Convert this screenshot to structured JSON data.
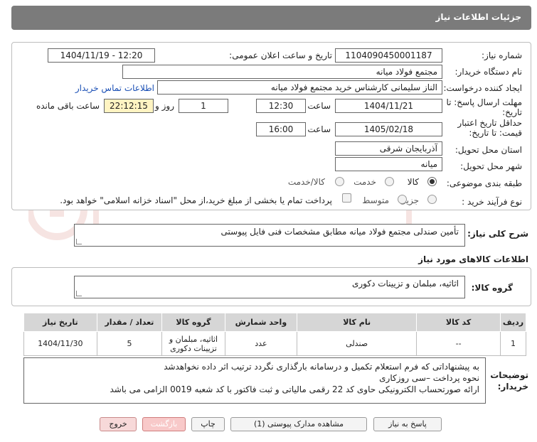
{
  "header": {
    "title": "جزئیات اطلاعات نیاز"
  },
  "form": {
    "need_number_label": "شماره نیاز:",
    "need_number": "1104090450001187",
    "announce_label": "تاریخ و ساعت اعلان عمومی:",
    "announce_value": "1404/11/19 - 12:20",
    "buyer_label": "نام دستگاه خریدار:",
    "buyer_value": "مجتمع فولاد میانه",
    "creator_label": "ایجاد کننده درخواست:",
    "creator_value": "الناز سلیمانی کارشناس خرید مجتمع فولاد میانه",
    "contact_link": "اطلاعات تماس خریدار",
    "deadline_label": "مهلت ارسال پاسخ: تا تاریخ:",
    "deadline_date": "1404/11/21",
    "time_label": "ساعت",
    "deadline_time": "12:30",
    "days_value": "1",
    "days_and_label": "روز و",
    "remaining_time": "22:12:15",
    "remaining_label": "ساعت باقی مانده",
    "validity_label": "حداقل تاریخ اعتبار قیمت: تا تاریخ:",
    "validity_date": "1405/02/18",
    "validity_time": "16:00",
    "province_label": "استان محل تحویل:",
    "province_value": "آذربایجان شرقی",
    "city_label": "شهر محل تحویل:",
    "city_value": "میانه",
    "category_label": "طبقه بندی موضوعی:",
    "category_options": [
      "کالا",
      "خدمت",
      "کالا/خدمت"
    ],
    "process_label": "نوع فرآیند خرید :",
    "process_options": [
      "جزیی",
      "متوسط"
    ],
    "payment_note": "پرداخت تمام یا بخشی از مبلغ خرید،از محل \"اسناد خزانه اسلامی\" خواهد بود."
  },
  "general": {
    "desc_label": "شرح کلی نیاز:",
    "desc_value": "تأمین صندلی مجتمع فولاد میانه مطابق مشخصات فنی فایل پیوستی",
    "goods_info_title": "اطلاعات کالاهای مورد نیاز",
    "goods_group_label": "گروه کالا:",
    "goods_group_value": "اثاثیه، مبلمان و تزیینات دکوری"
  },
  "table": {
    "headers": [
      "ردیف",
      "کد کالا",
      "نام کالا",
      "واحد شمارش",
      "گروه کالا",
      "تعداد / مقدار",
      "تاریخ نیاز"
    ],
    "rows": [
      [
        "1",
        "--",
        "صندلی",
        "عدد",
        "اثاثیه، مبلمان و تزیینات دکوری",
        "5",
        "1404/11/30"
      ]
    ]
  },
  "buyer_notes": {
    "label": "توضیحات خریدار:",
    "lines": [
      "به پیشنهاداتی که فرم استعلام تکمیل و درسامانه بارگذاری نگردد ترتیب اثر داده نخواهدشد",
      "نحوه پرداخت –سی روزکاری",
      "ارائه صورتحساب الکترونیکی حاوی کد 22 رقمی مالیاتی و ثبت فاکتور با کد شعبه 0019 الزامی می باشد"
    ]
  },
  "buttons": {
    "reply": "پاسخ به نیاز",
    "attachments": "مشاهده مدارک پیوستی (1)",
    "print": "چاپ",
    "back": "بازگشت",
    "exit": "خروج"
  },
  "colors": {
    "title_bar": "#7b7b7b",
    "link": "#1a4fb5",
    "highlight": "#fff4c2"
  }
}
